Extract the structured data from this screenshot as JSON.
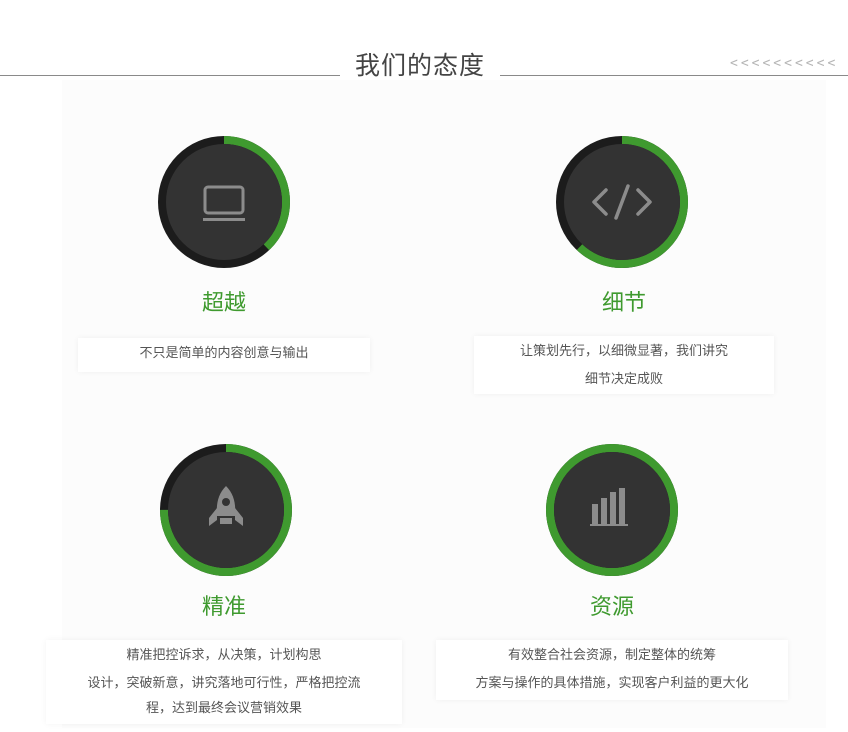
{
  "header": {
    "title": "我们的态度",
    "chevrons": "<<<<<<<<<<"
  },
  "colors": {
    "accent": "#3f9a2f",
    "ring_dark": "#1c1c1c",
    "circle_fill": "#333333",
    "icon_gray": "#8c8c8c"
  },
  "cards": [
    {
      "icon": "monitor-icon",
      "title": "超越",
      "progress": 0.38,
      "lines": [
        "不只是简单的内容创意与输出"
      ]
    },
    {
      "icon": "code-icon",
      "title": "细节",
      "progress": 0.62,
      "lines": [
        "让策划先行，以细微显著，我们讲究",
        "细节决定成败"
      ]
    },
    {
      "icon": "rocket-icon",
      "title": "精准",
      "progress": 0.75,
      "lines": [
        "精准把控诉求，从决策，计划构思",
        "设计，突破新意，讲究落地可行性，严格把控流",
        "程，达到最终会议营销效果"
      ]
    },
    {
      "icon": "bar-chart-icon",
      "title": "资源",
      "progress": 1.0,
      "lines": [
        "有效整合社会资源，制定整体的统筹",
        "方案与操作的具体措施，实现客户利益的更大化"
      ]
    }
  ]
}
